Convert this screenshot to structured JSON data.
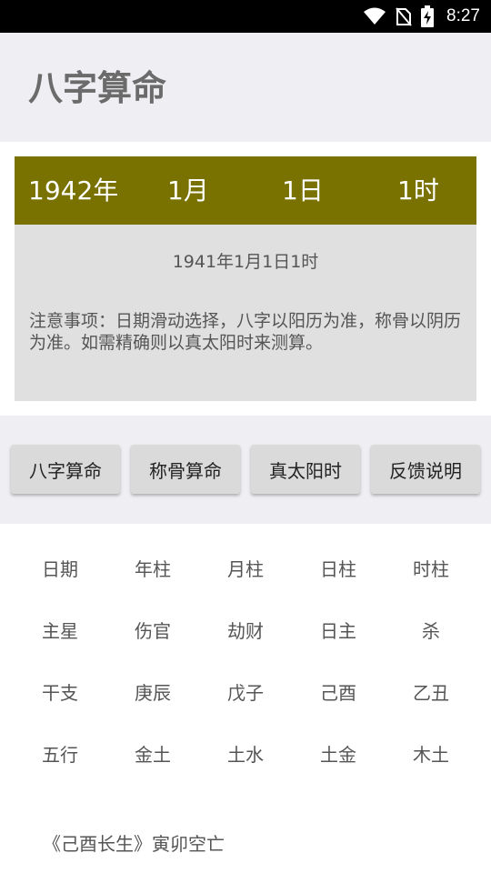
{
  "status_bar": {
    "time": "8:27",
    "icons": [
      "wifi-icon",
      "no-sim-icon",
      "battery-charging-icon"
    ]
  },
  "app_bar": {
    "title": "八字算命"
  },
  "date_picker": {
    "year": "1942年",
    "month": "1月",
    "day": "1日",
    "hour": "1时"
  },
  "info": {
    "lunar_date": "1941年1月1日1时",
    "notice": "注意事项：日期滑动选择，八字以阳历为准，称骨以阴历为准。如需精确则以真太阳时来测算。"
  },
  "buttons": {
    "bazi": "八字算命",
    "chenggu": "称骨算命",
    "solar_time": "真太阳时",
    "feedback": "反馈说明"
  },
  "table": {
    "rows": [
      [
        "日期",
        "年柱",
        "月柱",
        "日柱",
        "时柱"
      ],
      [
        "主星",
        "伤官",
        "劫财",
        "日主",
        "杀"
      ],
      [
        "干支",
        "庚辰",
        "戊子",
        "己酉",
        "乙丑"
      ],
      [
        "五行",
        "金土",
        "土水",
        "土金",
        "木土"
      ]
    ]
  },
  "footer": {
    "note": "《己酉长生》寅卯空亡"
  },
  "colors": {
    "date_bar": "#7a7200",
    "app_bar": "#efeff3",
    "info_panel": "#e0e0e0",
    "button": "#dadada"
  }
}
